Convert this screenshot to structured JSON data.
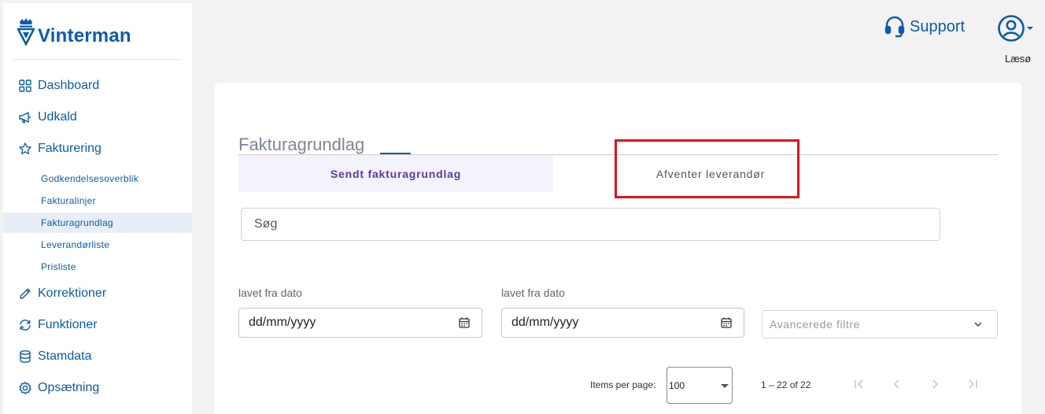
{
  "brand": {
    "name": "Vinterman",
    "color": "#0b5cab"
  },
  "sidebar": {
    "items": [
      {
        "label": "Dashboard",
        "icon": "dashboard-grid-icon"
      },
      {
        "label": "Udkald",
        "icon": "megaphone-icon"
      },
      {
        "label": "Fakturering",
        "icon": "star-icon"
      },
      {
        "label": "Korrektioner",
        "icon": "pencil-icon"
      },
      {
        "label": "Funktioner",
        "icon": "refresh-icon"
      },
      {
        "label": "Stamdata",
        "icon": "database-icon"
      },
      {
        "label": "Opsætning",
        "icon": "gear-icon"
      }
    ],
    "subitems": [
      {
        "label": "Godkendelsesoverblik"
      },
      {
        "label": "Fakturalinjer"
      },
      {
        "label": "Fakturagrundlag",
        "active": true
      },
      {
        "label": "Leverandørliste"
      },
      {
        "label": "Prisliste"
      }
    ]
  },
  "header": {
    "support_label": "Support",
    "user_name": "Læsø"
  },
  "main": {
    "title": "Fakturagrundlag",
    "tabs": [
      {
        "label": "Sendt fakturagrundlag",
        "active": true
      },
      {
        "label": "Afventer leverandør",
        "active": false
      }
    ],
    "search_placeholder": "Søg",
    "filters": {
      "date_from_label": "lavet fra dato",
      "date_from_placeholder": "dd/mm/yyyy",
      "date_to_label": "lavet fra dato",
      "date_to_placeholder": "dd/mm/yyyy",
      "advanced_label": "Avancerede filtre"
    },
    "paginator": {
      "items_per_page_label": "Items per page:",
      "page_size": "100",
      "range_label": "1 – 22 of 22"
    }
  },
  "colors": {
    "accent": "#0b5cab",
    "tab_active": "#5b3aa3",
    "highlight": "#e0151d"
  }
}
